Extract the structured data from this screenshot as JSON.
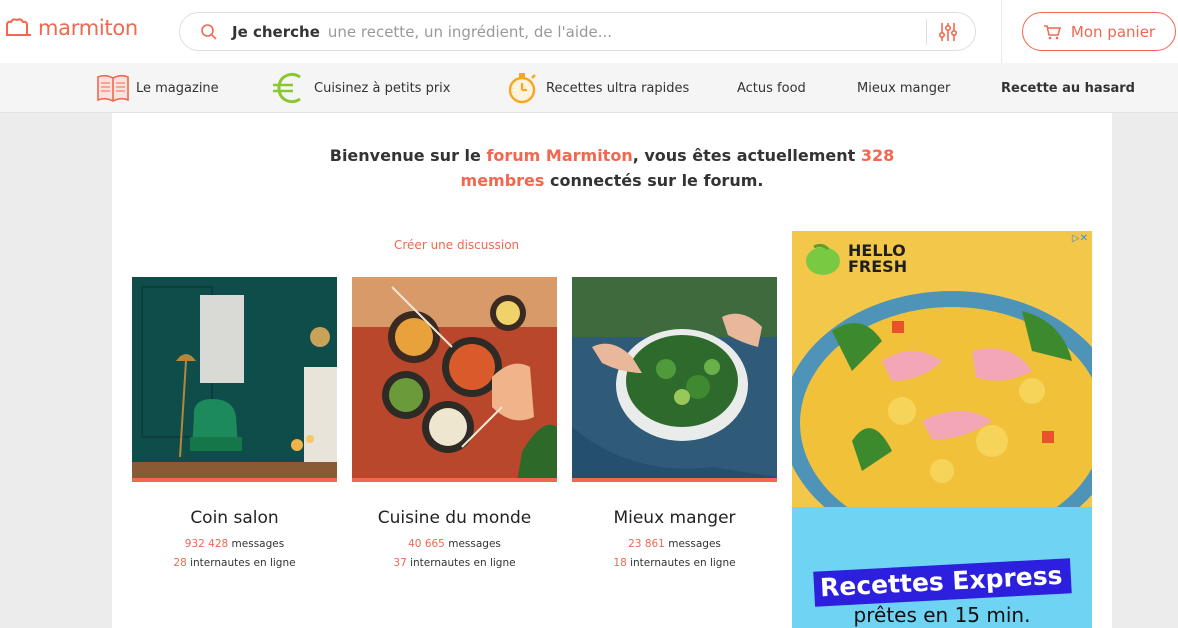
{
  "header": {
    "logo_text": "marmiton",
    "search": {
      "label": "Je cherche",
      "placeholder": "une recette, un ingrédient, de l'aide..."
    },
    "cart_label": "Mon panier"
  },
  "nav": {
    "items": [
      {
        "label": "Le magazine",
        "icon": "book-icon"
      },
      {
        "label": "Cuisinez à petits prix",
        "icon": "euro-icon"
      },
      {
        "label": "Recettes ultra rapides",
        "icon": "stopwatch-icon"
      },
      {
        "label": "Actus food"
      },
      {
        "label": "Mieux manger"
      },
      {
        "label": "Recette au hasard"
      }
    ]
  },
  "welcome": {
    "prefix": "Bienvenue sur le ",
    "forum_name": "forum Marmiton",
    "middle": ", vous êtes actuellement ",
    "count": "328",
    "members": "membres",
    "suffix": " connectés sur le forum."
  },
  "create_discussion": "Créer une discussion",
  "forums": [
    {
      "title": "Coin salon",
      "messages_count": "932 428",
      "messages_label": " messages",
      "online_count": "28",
      "online_label": " internautes en ligne"
    },
    {
      "title": "Cuisine du monde",
      "messages_count": "40 665",
      "messages_label": " messages",
      "online_count": "37",
      "online_label": " internautes en ligne"
    },
    {
      "title": "Mieux manger",
      "messages_count": "23 861",
      "messages_label": " messages",
      "online_count": "18",
      "online_label": " internautes en ligne"
    }
  ],
  "ad": {
    "brand_line1": "HELLO",
    "brand_line2": "FRESH",
    "headline": "Recettes Express",
    "subline": "prêtes en 15 min."
  },
  "colors": {
    "accent": "#f2674f",
    "nav_bg": "#f5f5f5",
    "page_bg": "#ececec"
  }
}
